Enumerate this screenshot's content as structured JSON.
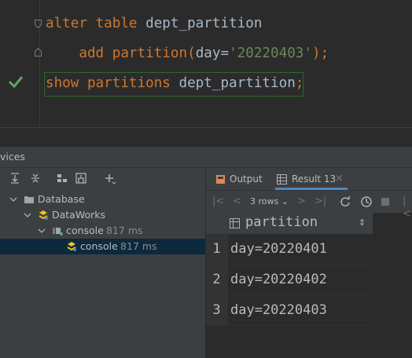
{
  "editor": {
    "line1": {
      "kw1": "alter",
      "kw2": "table",
      "ident": "dept_partition"
    },
    "line2": {
      "kw1": "add",
      "kw2": "partition",
      "open": "(",
      "param": "day=",
      "value": "'20220403'",
      "close": ");"
    },
    "line3": {
      "kw1": "show",
      "kw2": "partitions",
      "ident": "dept_partition",
      "end": ";"
    },
    "status_icon": "check-icon",
    "status_color": "#59a869"
  },
  "services": {
    "title": "vices"
  },
  "tree": {
    "items": [
      {
        "label": "Database",
        "icon": "folder-icon"
      },
      {
        "label": "DataWorks",
        "icon": "datasource-icon"
      },
      {
        "label": "console",
        "time": "817 ms",
        "icon": "session-icon"
      },
      {
        "label": "console",
        "time": "817 ms",
        "icon": "console-icon"
      }
    ]
  },
  "results": {
    "tabs": [
      {
        "label": "Output",
        "icon": "output-icon"
      },
      {
        "label": "Result 13",
        "icon": "table-icon",
        "close": "×"
      }
    ],
    "rows_selector": "3 rows",
    "column_header": "partition",
    "rows": [
      {
        "n": "1",
        "value": "day=20220401"
      },
      {
        "n": "2",
        "value": "day=20220402"
      },
      {
        "n": "3",
        "value": "day=20220403"
      }
    ]
  },
  "colors": {
    "keyword": "#cc7832",
    "string": "#6a8759",
    "identifier": "#a9b7c6",
    "accent": "#4a88c7"
  }
}
